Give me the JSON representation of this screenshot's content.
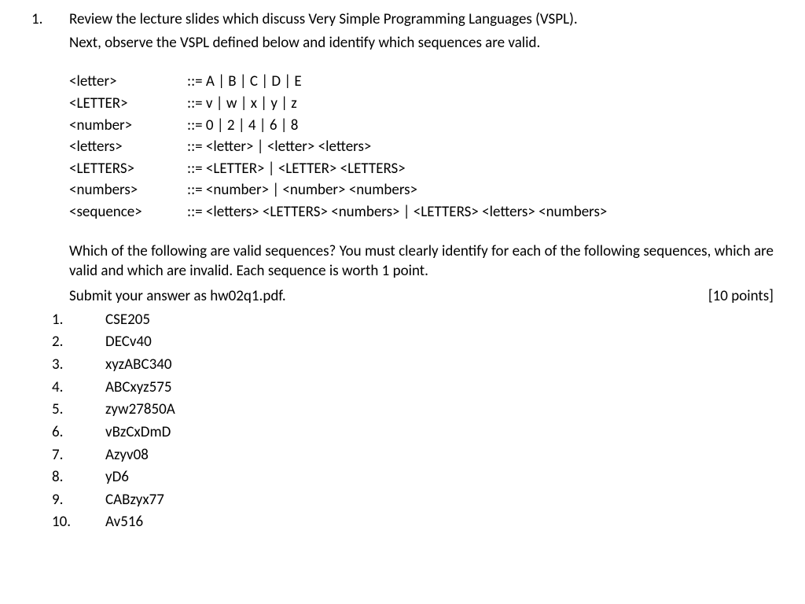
{
  "question_number": "1.",
  "intro_line1": "Review the lecture slides which discuss Very Simple Programming Languages (VSPL).",
  "intro_line2": "Next, observe the VSPL defined below and identify which sequences are valid.",
  "grammar": [
    {
      "lhs": "<letter>",
      "rhs": "::= A | B | C | D | E"
    },
    {
      "lhs": "<LETTER>",
      "rhs": "::= v | w | x | y | z"
    },
    {
      "lhs": "<number>",
      "rhs": "::= 0 | 2 | 4 | 6 | 8"
    },
    {
      "lhs": "<letters>",
      "rhs": "::= <letter> | <letter> <letters>"
    },
    {
      "lhs": "<LETTERS>",
      "rhs": "::= <LETTER> | <LETTER> <LETTERS>"
    },
    {
      "lhs": "<numbers>",
      "rhs": "::= <number> | <number> <numbers>"
    },
    {
      "lhs": "<sequence>",
      "rhs": "::= <letters> <LETTERS> <numbers> | <LETTERS> <letters> <numbers>"
    }
  ],
  "instructions": "Which of the following are valid sequences? You must clearly identify for each of the following sequences, which are valid and which are invalid. Each sequence is worth 1 point.",
  "submit_text": "Submit your answer as hw02q1.pdf.",
  "points_text": "[10 points]",
  "sequences": [
    {
      "n": "1.",
      "v": "CSE205"
    },
    {
      "n": "2.",
      "v": "DECv40"
    },
    {
      "n": "3.",
      "v": "xyzABC340"
    },
    {
      "n": "4.",
      "v": "ABCxyz575"
    },
    {
      "n": "5.",
      "v": "zyw27850A"
    },
    {
      "n": "6.",
      "v": "vBzCxDmD"
    },
    {
      "n": "7.",
      "v": "Azyv08"
    },
    {
      "n": "8.",
      "v": "yD6"
    },
    {
      "n": "9.",
      "v": "CABzyx77"
    },
    {
      "n": "10.",
      "v": "Av516"
    }
  ]
}
